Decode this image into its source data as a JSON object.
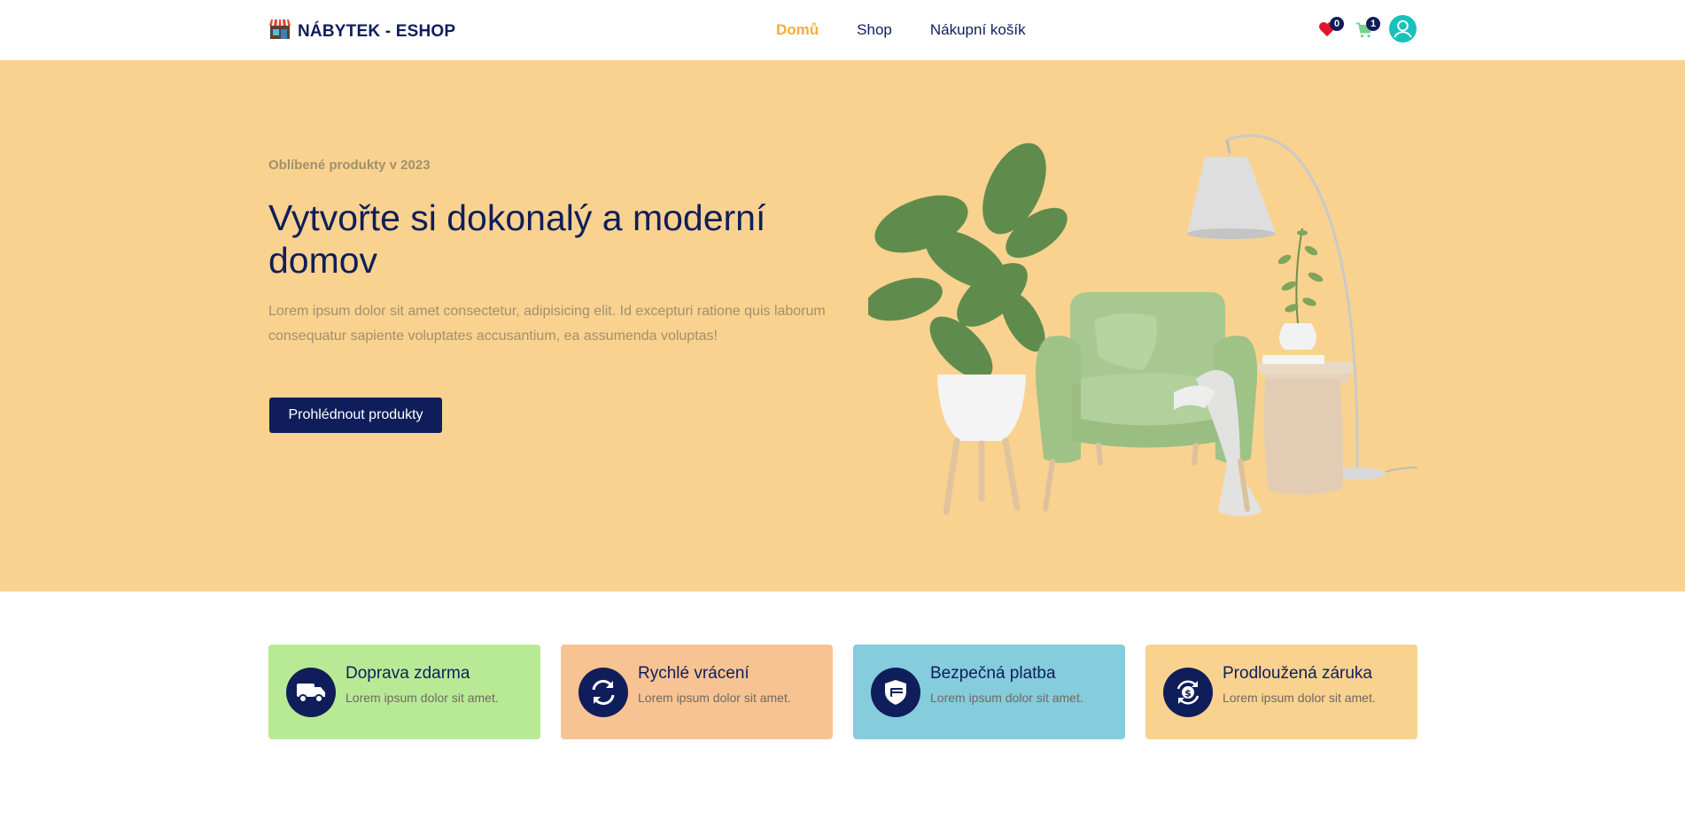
{
  "brand": {
    "name": "NÁBYTEK - ESHOP",
    "icon": "storefront-icon"
  },
  "nav": [
    {
      "label": "Domů",
      "active": true
    },
    {
      "label": "Shop",
      "active": false
    },
    {
      "label": "Nákupní košík",
      "active": false
    }
  ],
  "header_icons": {
    "wishlist": {
      "icon": "heart-icon",
      "count": "0"
    },
    "cart": {
      "icon": "cart-icon",
      "count": "1"
    },
    "account": {
      "icon": "user-icon"
    }
  },
  "hero": {
    "eyebrow": "Oblíbené produkty v 2023",
    "title": "Vytvořte si dokonalý a moderní domov",
    "description": "Lorem ipsum dolor sit amet consectetur, adipisicing elit. Id excepturi ratione quis laborum consequatur sapiente voluptates accusantium, ea assumenda voluptas!",
    "cta_label": "Prohlédnout produkty"
  },
  "features": [
    {
      "title": "Doprava zdarma",
      "subtitle": "Lorem ipsum dolor sit amet.",
      "icon": "truck-icon",
      "color": "#b8ea95"
    },
    {
      "title": "Rychlé vrácení",
      "subtitle": "Lorem ipsum dolor sit amet.",
      "icon": "refresh-icon",
      "color": "#f8c393"
    },
    {
      "title": "Bezpečná platba",
      "subtitle": "Lorem ipsum dolor sit amet.",
      "icon": "shield-card-icon",
      "color": "#85ccdc"
    },
    {
      "title": "Prodloužená záruka",
      "subtitle": "Lorem ipsum dolor sit amet.",
      "icon": "money-cycle-icon",
      "color": "#f9d28f"
    }
  ],
  "colors": {
    "navy": "#0f1e5a",
    "accent": "#f6ad37",
    "hero_bg": "#f9d28f",
    "heart": "#e0142a",
    "cart": "#74d38c",
    "avatar": "#17c2bb"
  }
}
